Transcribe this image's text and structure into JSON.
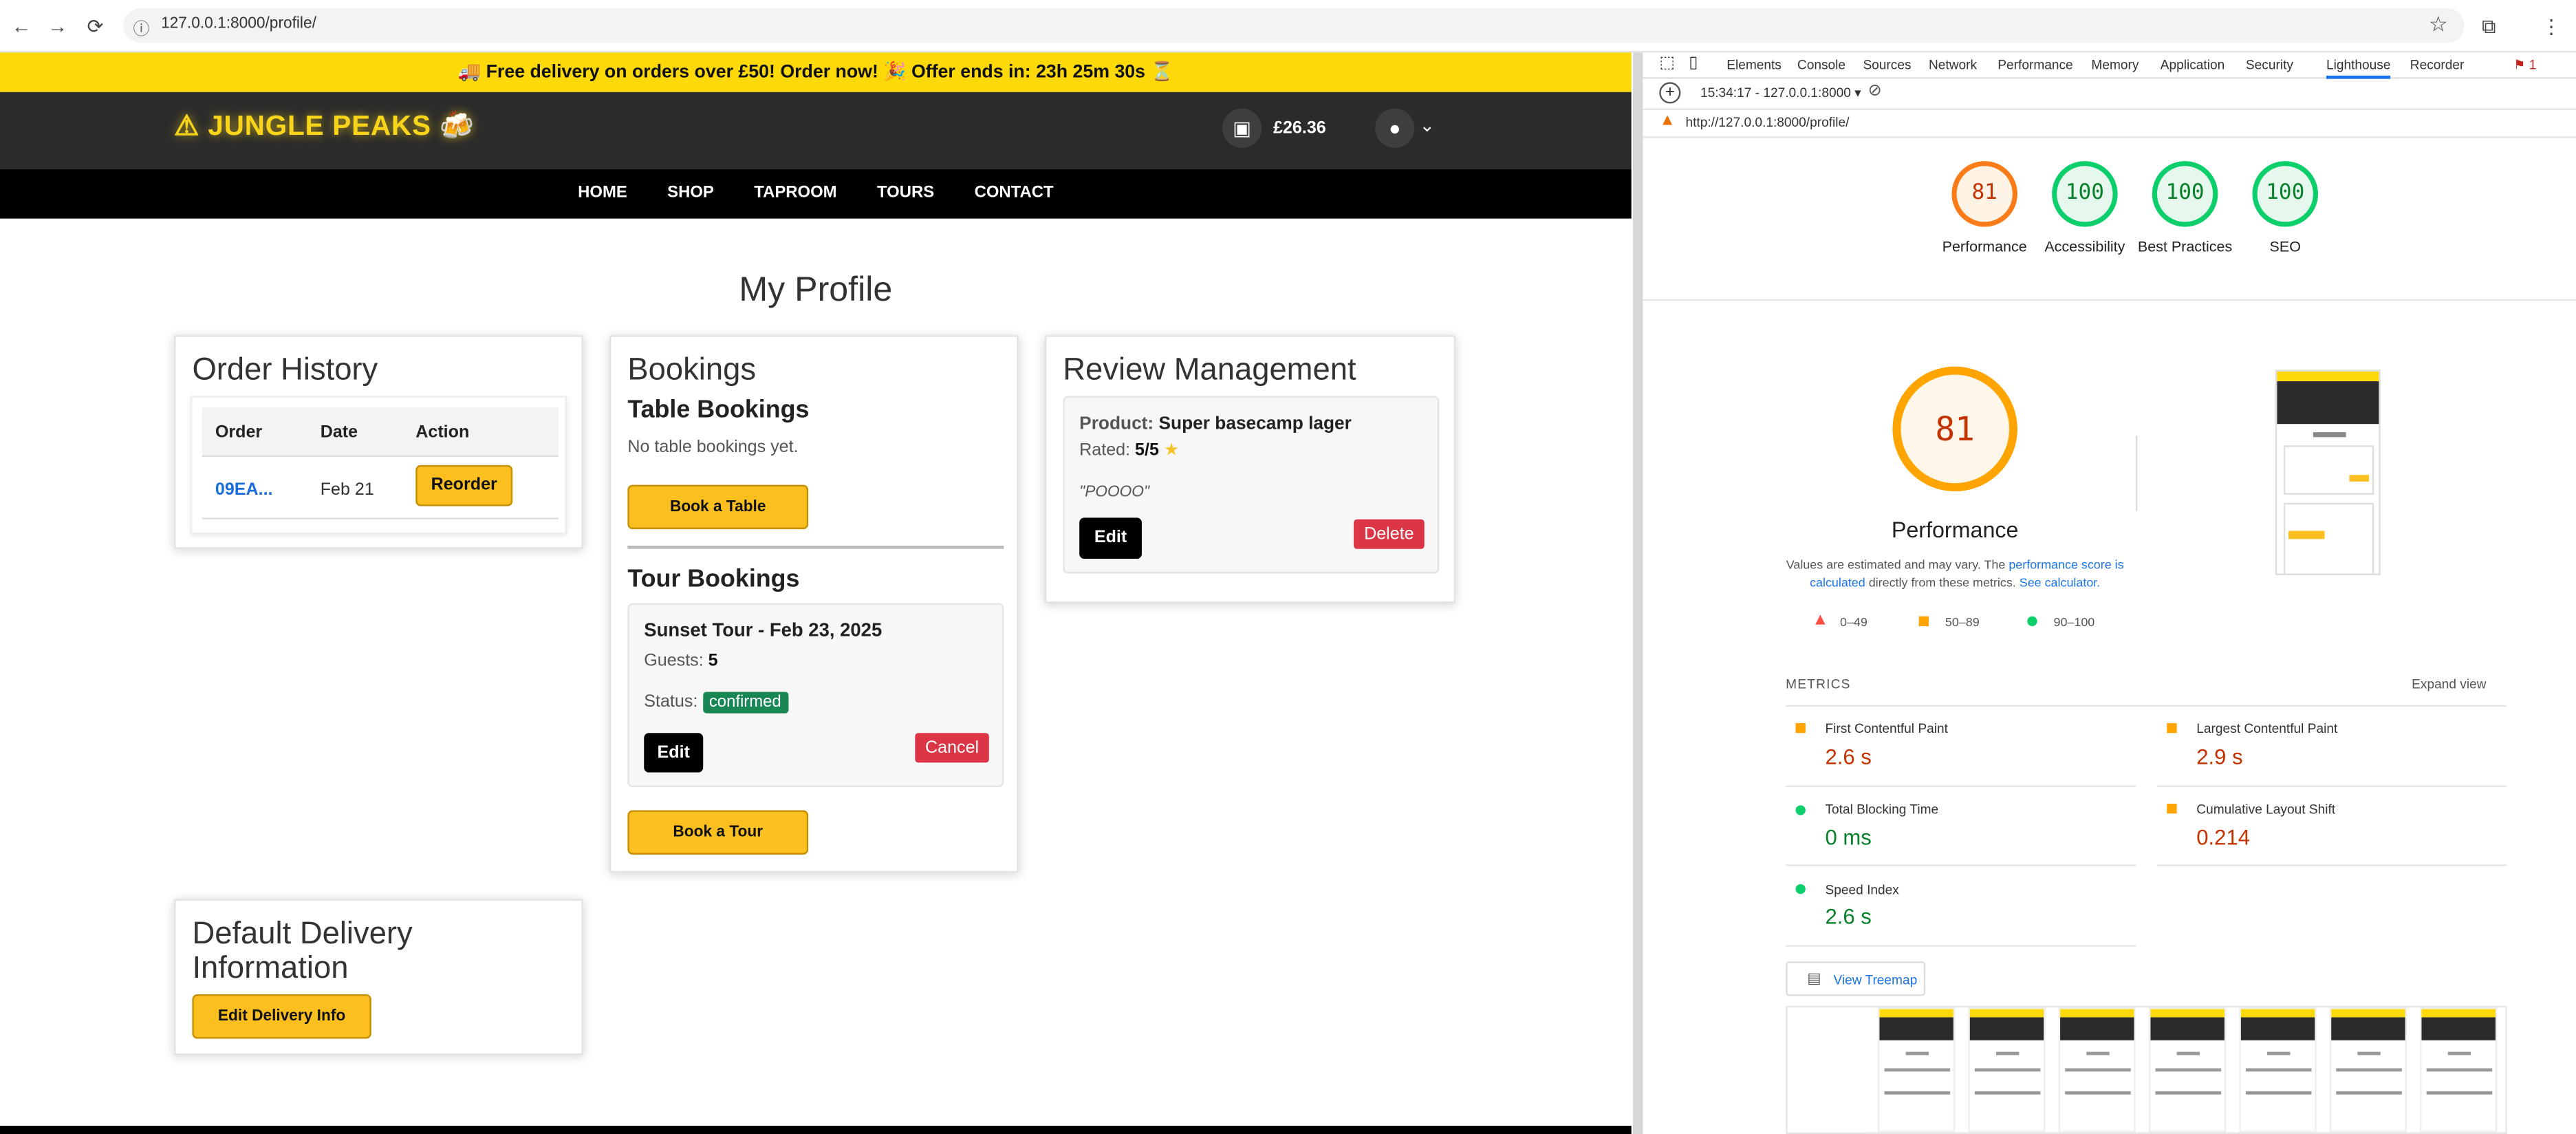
{
  "browser": {
    "url": "127.0.0.1:8000/profile/"
  },
  "site": {
    "banner": "🚚 Free delivery on orders over £50! Order now! 🎉 Offer ends in: 23h 25m 30s ⏳",
    "logo": "⚠ JUNGLE PEAKS 🍻",
    "cart_total": "£26.36",
    "nav": [
      "HOME",
      "SHOP",
      "TAPROOM",
      "TOURS",
      "CONTACT"
    ],
    "page_title": "My Profile",
    "order_history": {
      "title": "Order History",
      "columns": [
        "Order",
        "Date",
        "Action"
      ],
      "rows": [
        {
          "order": "09EA...",
          "date": "Feb 21",
          "action": "Reorder"
        }
      ]
    },
    "bookings": {
      "title": "Bookings",
      "table_title": "Table Bookings",
      "table_empty": "No table bookings yet.",
      "book_table": "Book a Table",
      "tour_title": "Tour Bookings",
      "tour": {
        "name": "Sunset Tour - Feb 23, 2025",
        "guests_label": "Guests:",
        "guests": "5",
        "status_label": "Status:",
        "status": "confirmed",
        "edit": "Edit",
        "cancel": "Cancel"
      },
      "book_tour": "Book a Tour"
    },
    "reviews": {
      "title": "Review Management",
      "product_label": "Product:",
      "product": "Super basecamp lager",
      "rated_label": "Rated:",
      "rated": "5/5",
      "text": "\"POOOO\"",
      "edit": "Edit",
      "delete": "Delete"
    },
    "delivery": {
      "title": "Default Delivery Information",
      "button": "Edit Delivery Info"
    }
  },
  "devtools": {
    "tabs": [
      "Elements",
      "Console",
      "Sources",
      "Network",
      "Performance",
      "Memory",
      "Application",
      "Security",
      "Lighthouse",
      "Recorder"
    ],
    "active_tab": "Lighthouse",
    "issues_count": "1",
    "report_time": "15:34:17 - 127.0.0.1:8000 ▾",
    "report_url": "http://127.0.0.1:8000/profile/",
    "scores": [
      {
        "value": "81",
        "label": "Performance",
        "color": "#fa7b17"
      },
      {
        "value": "100",
        "label": "Accessibility",
        "color": "#0cce6b"
      },
      {
        "value": "100",
        "label": "Best Practices",
        "color": "#0cce6b"
      },
      {
        "value": "100",
        "label": "SEO",
        "color": "#0cce6b"
      }
    ],
    "perf_score": "81",
    "perf_title": "Performance",
    "perf_note_1": "Values are estimated and may vary. The ",
    "perf_note_link": "performance score is calculated",
    "perf_note_2": " directly from these metrics. ",
    "perf_note_link2": "See calculator.",
    "legend": [
      "0–49",
      "50–89",
      "90–100"
    ],
    "metrics_title": "METRICS",
    "expand_view": "Expand view",
    "metrics": [
      {
        "label": "First Contentful Paint",
        "value": "2.6 s",
        "status": "average"
      },
      {
        "label": "Largest Contentful Paint",
        "value": "2.9 s",
        "status": "average"
      },
      {
        "label": "Total Blocking Time",
        "value": "0 ms",
        "status": "pass"
      },
      {
        "label": "Cumulative Layout Shift",
        "value": "0.214",
        "status": "average"
      },
      {
        "label": "Speed Index",
        "value": "2.6 s",
        "status": "pass"
      }
    ],
    "treemap": "View Treemap",
    "colors": {
      "pass": "#0cce6b",
      "average": "#ffa400",
      "fail": "#ff4e42"
    }
  }
}
